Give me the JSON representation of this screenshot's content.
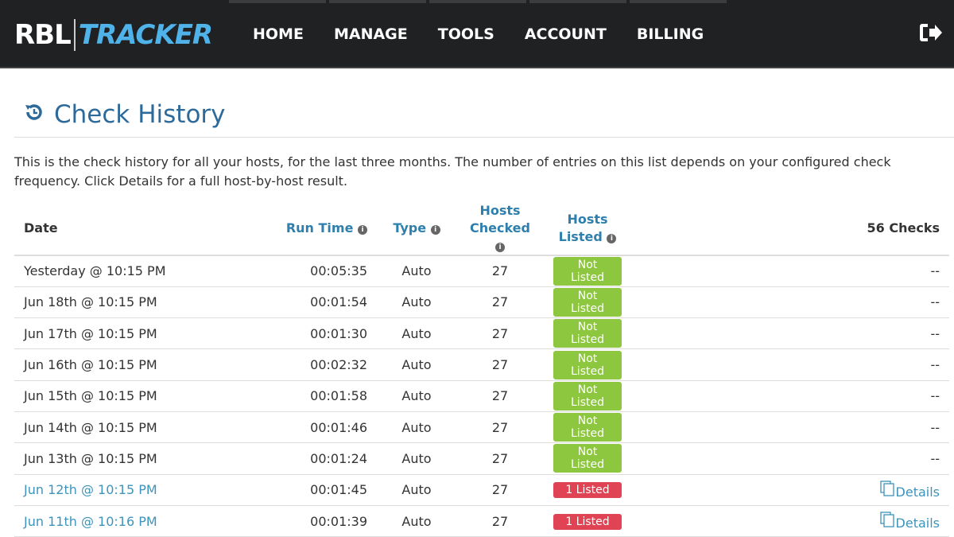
{
  "nav": {
    "logo_left": "RBL",
    "logo_right": "TRACKER",
    "items": [
      "HOME",
      "MANAGE",
      "TOOLS",
      "ACCOUNT",
      "BILLING"
    ]
  },
  "page": {
    "title": "Check History",
    "intro": "This is the check history for all your hosts, for the last three months. The number of entries on this list depends on your configured check frequency. Click Details for a full host-by-host result."
  },
  "table": {
    "headers": {
      "date": "Date",
      "run_time": "Run Time",
      "type": "Type",
      "hosts_checked": "Hosts Checked",
      "hosts_listed": "Hosts Listed",
      "count": "56 Checks"
    },
    "rows": [
      {
        "date": "Yesterday @ 10:15 PM",
        "run": "00:05:35",
        "type": "Auto",
        "checked": "27",
        "status": "Not Listed",
        "action": "--"
      },
      {
        "date": "Jun 18th @ 10:15 PM",
        "run": "00:01:54",
        "type": "Auto",
        "checked": "27",
        "status": "Not Listed",
        "action": "--"
      },
      {
        "date": "Jun 17th @ 10:15 PM",
        "run": "00:01:30",
        "type": "Auto",
        "checked": "27",
        "status": "Not Listed",
        "action": "--"
      },
      {
        "date": "Jun 16th @ 10:15 PM",
        "run": "00:02:32",
        "type": "Auto",
        "checked": "27",
        "status": "Not Listed",
        "action": "--"
      },
      {
        "date": "Jun 15th @ 10:15 PM",
        "run": "00:01:58",
        "type": "Auto",
        "checked": "27",
        "status": "Not Listed",
        "action": "--"
      },
      {
        "date": "Jun 14th @ 10:15 PM",
        "run": "00:01:46",
        "type": "Auto",
        "checked": "27",
        "status": "Not Listed",
        "action": "--"
      },
      {
        "date": "Jun 13th @ 10:15 PM",
        "run": "00:01:24",
        "type": "Auto",
        "checked": "27",
        "status": "Not Listed",
        "action": "--"
      },
      {
        "date": "Jun 12th @ 10:15 PM",
        "run": "00:01:45",
        "type": "Auto",
        "checked": "27",
        "status": "1 Listed",
        "action": "Details"
      },
      {
        "date": "Jun 11th @ 10:16 PM",
        "run": "00:01:39",
        "type": "Auto",
        "checked": "27",
        "status": "1 Listed",
        "action": "Details"
      }
    ]
  }
}
